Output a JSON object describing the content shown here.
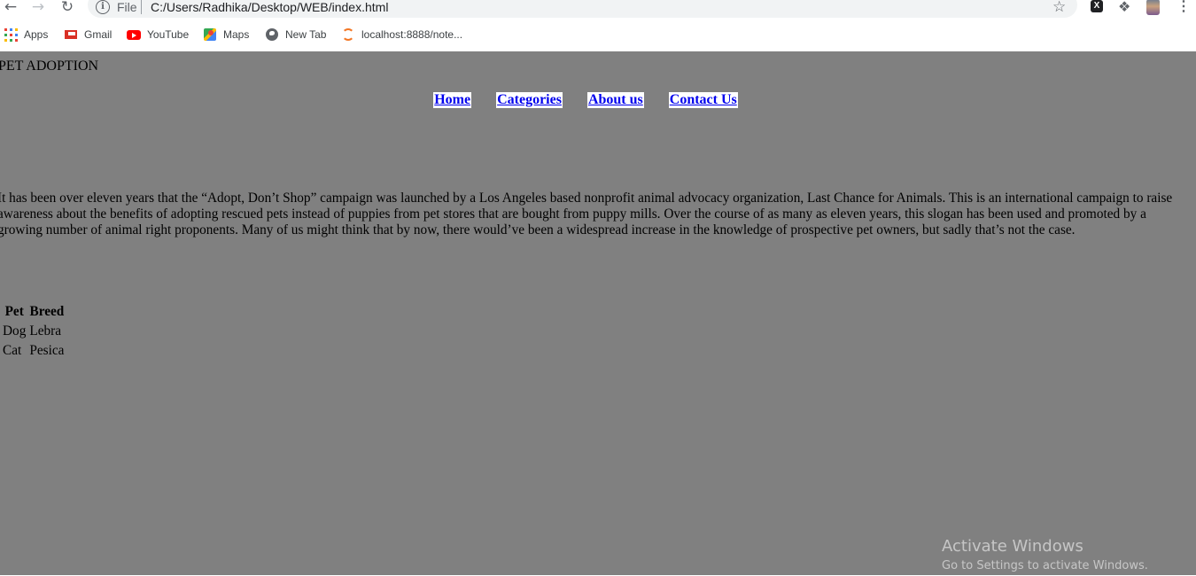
{
  "browser": {
    "scheme_label": "File",
    "url": "C:/Users/Radhika/Desktop/WEB/index.html",
    "bookmarks": [
      {
        "label": "Apps",
        "icon": "apps-grid-icon"
      },
      {
        "label": "Gmail",
        "icon": "gmail-icon"
      },
      {
        "label": "YouTube",
        "icon": "youtube-icon"
      },
      {
        "label": "Maps",
        "icon": "maps-icon"
      },
      {
        "label": "New Tab",
        "icon": "globe-icon"
      },
      {
        "label": "localhost:8888/note...",
        "icon": "jupyter-icon"
      }
    ]
  },
  "page": {
    "title": "PET ADOPTION",
    "nav": [
      "Home",
      "Categories",
      "About us",
      "Contact Us"
    ],
    "intro": "It has been over eleven years that the “Adopt, Don’t Shop” campaign was launched by a Los Angeles based nonprofit animal advocacy organization, Last Chance for Animals. This is an international campaign to raise awareness about the benefits of adopting rescued pets instead of puppies from pet stores that are bought from puppy mills. Over the course of as many as eleven years, this slogan has been used and promoted by a growing number of animal right proponents. Many of us might think that by now, there would’ve been a widespread increase in the knowledge of prospective pet owners, but sadly that’s not the case.",
    "table": {
      "headers": [
        "Pet",
        "Breed"
      ],
      "rows": [
        [
          "Dog",
          "Lebra"
        ],
        [
          "Cat",
          "Pesica"
        ]
      ]
    },
    "background_color": "#808080",
    "link_color": "#0000ee"
  },
  "watermark": {
    "title": "Activate Windows",
    "subtitle": "Go to Settings to activate Windows."
  }
}
